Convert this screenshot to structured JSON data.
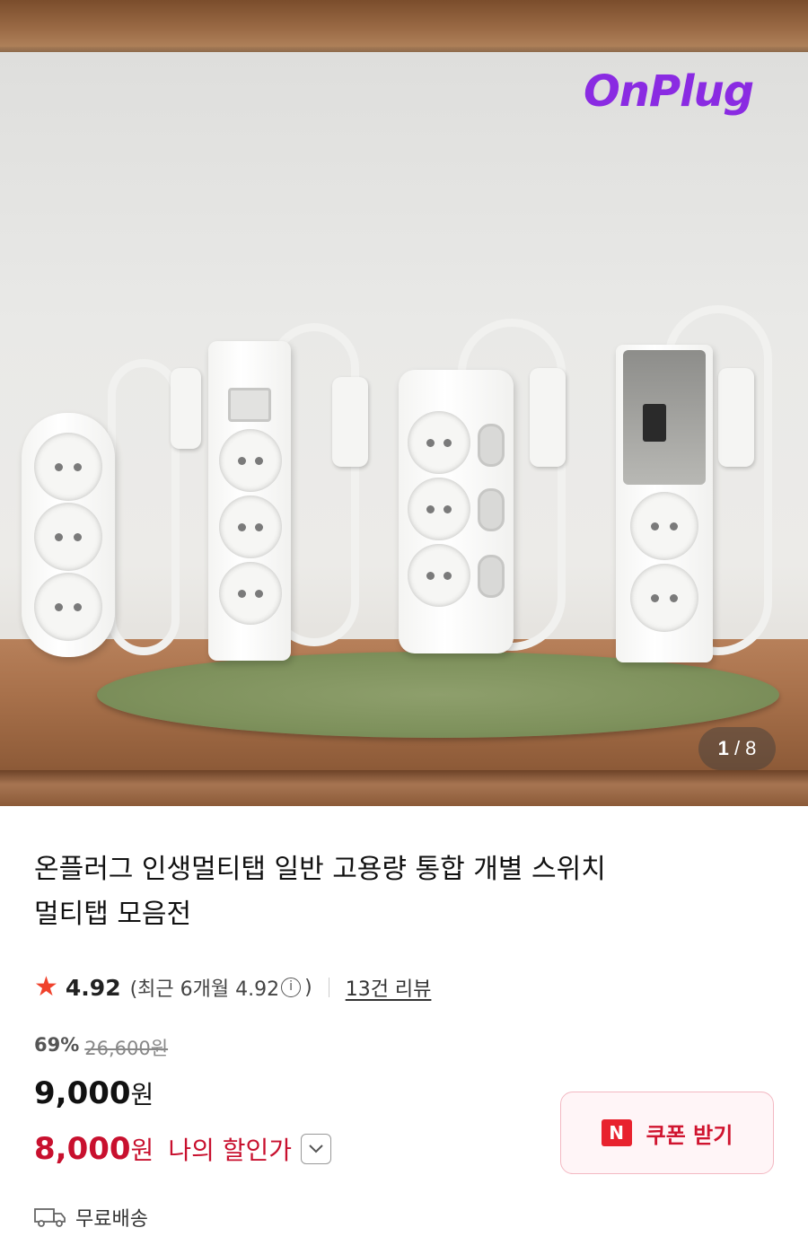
{
  "hero": {
    "brand_logo": "OnPlug",
    "counter_current": "1",
    "counter_total": "8"
  },
  "product": {
    "title_line1": "온플러그 인생멀티탭 일반 고용량 통합 개별 스위치",
    "title_line2": "멀티탭 모음전"
  },
  "rating": {
    "star_icon": "star-icon",
    "score": "4.92",
    "recent_open": "(최근 6개월 4.92",
    "info_icon": "i",
    "recent_close": ")",
    "reviews_link": "13건 리뷰"
  },
  "pricing": {
    "discount_percent": "69%",
    "original_price": "26,600원",
    "sale_amount": "9,000",
    "sale_unit": "원",
    "my_amount": "8,000",
    "my_unit": "원",
    "my_label": "나의 할인가",
    "chevron_icon": "chevron-down-icon"
  },
  "coupon": {
    "badge": "N",
    "label": "쿠폰 받기"
  },
  "shipping": {
    "icon": "truck-icon",
    "label": "무료배송"
  },
  "colors": {
    "accent_red": "#c8102e",
    "star": "#f0412b",
    "brand_purple": "#8a2be2"
  }
}
